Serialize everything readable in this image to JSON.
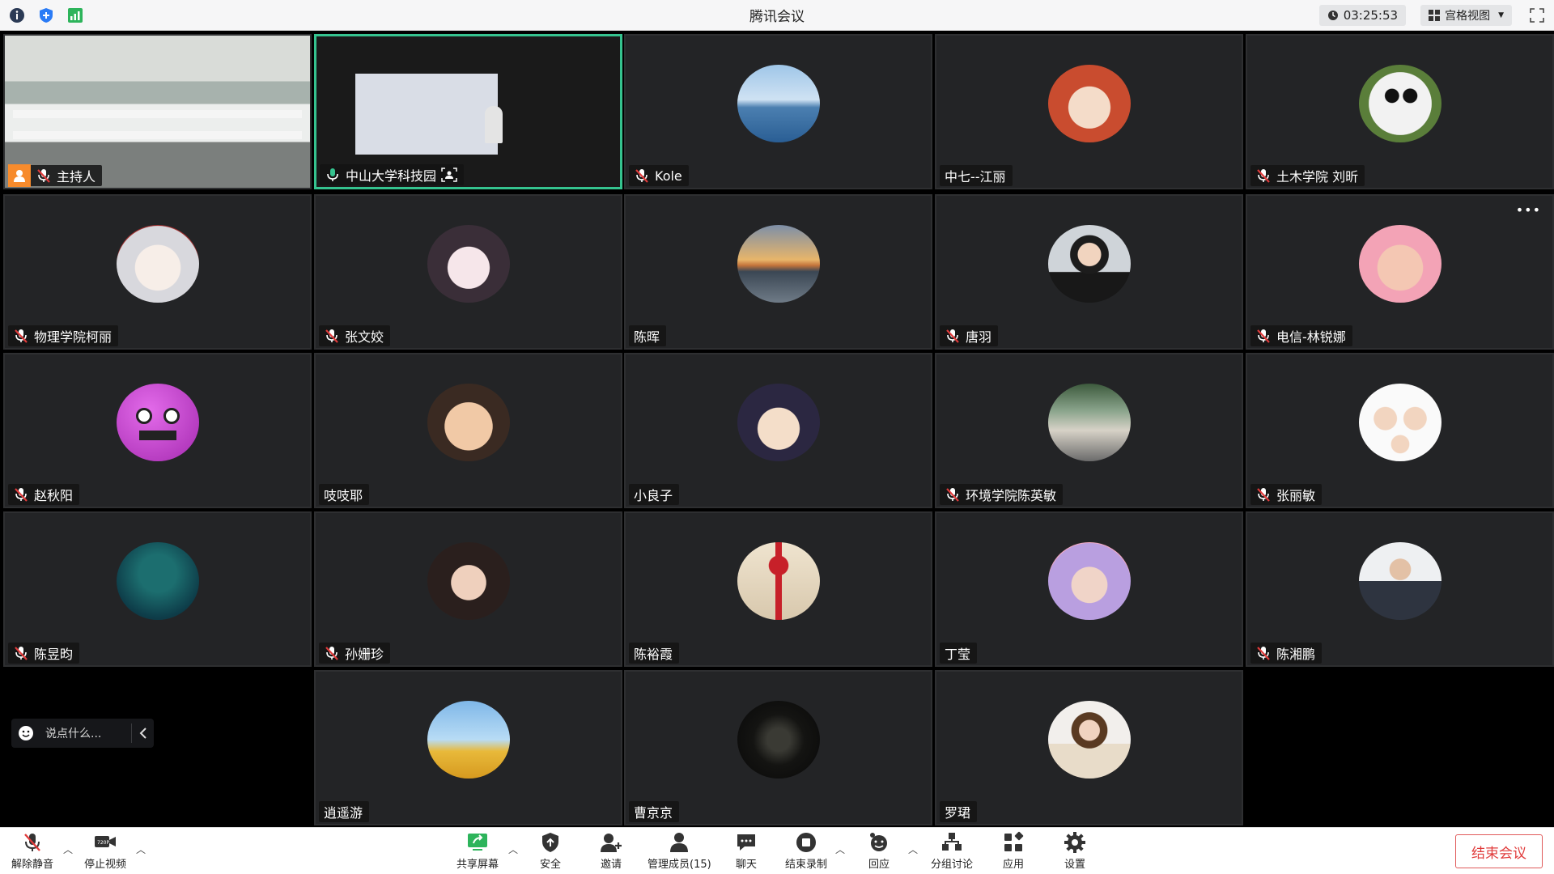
{
  "window": {
    "title": "腾讯会议"
  },
  "header": {
    "timer": "03:25:53",
    "view_label": "宫格视图"
  },
  "participants": [
    {
      "name": "主持人",
      "host": true,
      "muted": true,
      "avatar": "classroom-video"
    },
    {
      "name": "中山大学科技园",
      "host": false,
      "muted": false,
      "speaking": true,
      "avatar": "presentation-video"
    },
    {
      "name": "Kole",
      "muted": true,
      "avatar": "seaside-photo"
    },
    {
      "name": "中七--江丽",
      "muted": false,
      "avatar": "anime-girl-redhair"
    },
    {
      "name": "土木学院 刘昕",
      "muted": true,
      "avatar": "panda"
    },
    {
      "name": "物理学院柯丽",
      "muted": true,
      "avatar": "anime-white-hair"
    },
    {
      "name": "张文姣",
      "muted": true,
      "avatar": "anime-girl-dark"
    },
    {
      "name": "陈晖",
      "muted": false,
      "avatar": "sunset-river"
    },
    {
      "name": "唐羽",
      "muted": true,
      "avatar": "woman-portrait"
    },
    {
      "name": "电信-林锐娜",
      "muted": true,
      "avatar": "child-pink"
    },
    {
      "name": "赵秋阳",
      "muted": true,
      "avatar": "purple-monster"
    },
    {
      "name": "吱吱耶",
      "muted": false,
      "avatar": "smiling-child"
    },
    {
      "name": "小良子",
      "muted": false,
      "avatar": "anime-boy"
    },
    {
      "name": "环境学院陈英敏",
      "muted": true,
      "avatar": "street-photo"
    },
    {
      "name": "张丽敏",
      "muted": true,
      "avatar": "family-cartoon"
    },
    {
      "name": "陈昱昀",
      "muted": true,
      "avatar": "moon-silhouette"
    },
    {
      "name": "孙姗珍",
      "muted": true,
      "avatar": "woman-selfie"
    },
    {
      "name": "陈裕霞",
      "muted": false,
      "avatar": "gift-rose"
    },
    {
      "name": "丁莹",
      "muted": false,
      "avatar": "woman-bokeh"
    },
    {
      "name": "陈湘鹏",
      "muted": true,
      "avatar": "man-suit"
    },
    {
      "name": "逍遥游",
      "muted": false,
      "avatar": "cartoon-sky"
    },
    {
      "name": "曹京京",
      "muted": false,
      "avatar": "dark-moon"
    },
    {
      "name": "罗珺",
      "muted": false,
      "avatar": "woman-blazer"
    }
  ],
  "chat": {
    "placeholder": "说点什么..."
  },
  "toolbar": {
    "unmute": "解除静音",
    "stop_video": "停止视频",
    "share_screen": "共享屏幕",
    "security": "安全",
    "invite": "邀请",
    "manage_members": "管理成员(15)",
    "chat": "聊天",
    "end_recording": "结束录制",
    "reaction": "回应",
    "breakout": "分组讨论",
    "apps": "应用",
    "settings": "设置",
    "end_meeting": "结束会议"
  },
  "colors": {
    "active_border": "#35c38f",
    "end_red": "#e03b3b",
    "host_orange": "#f78b2c",
    "tile_bg": "#232426"
  }
}
